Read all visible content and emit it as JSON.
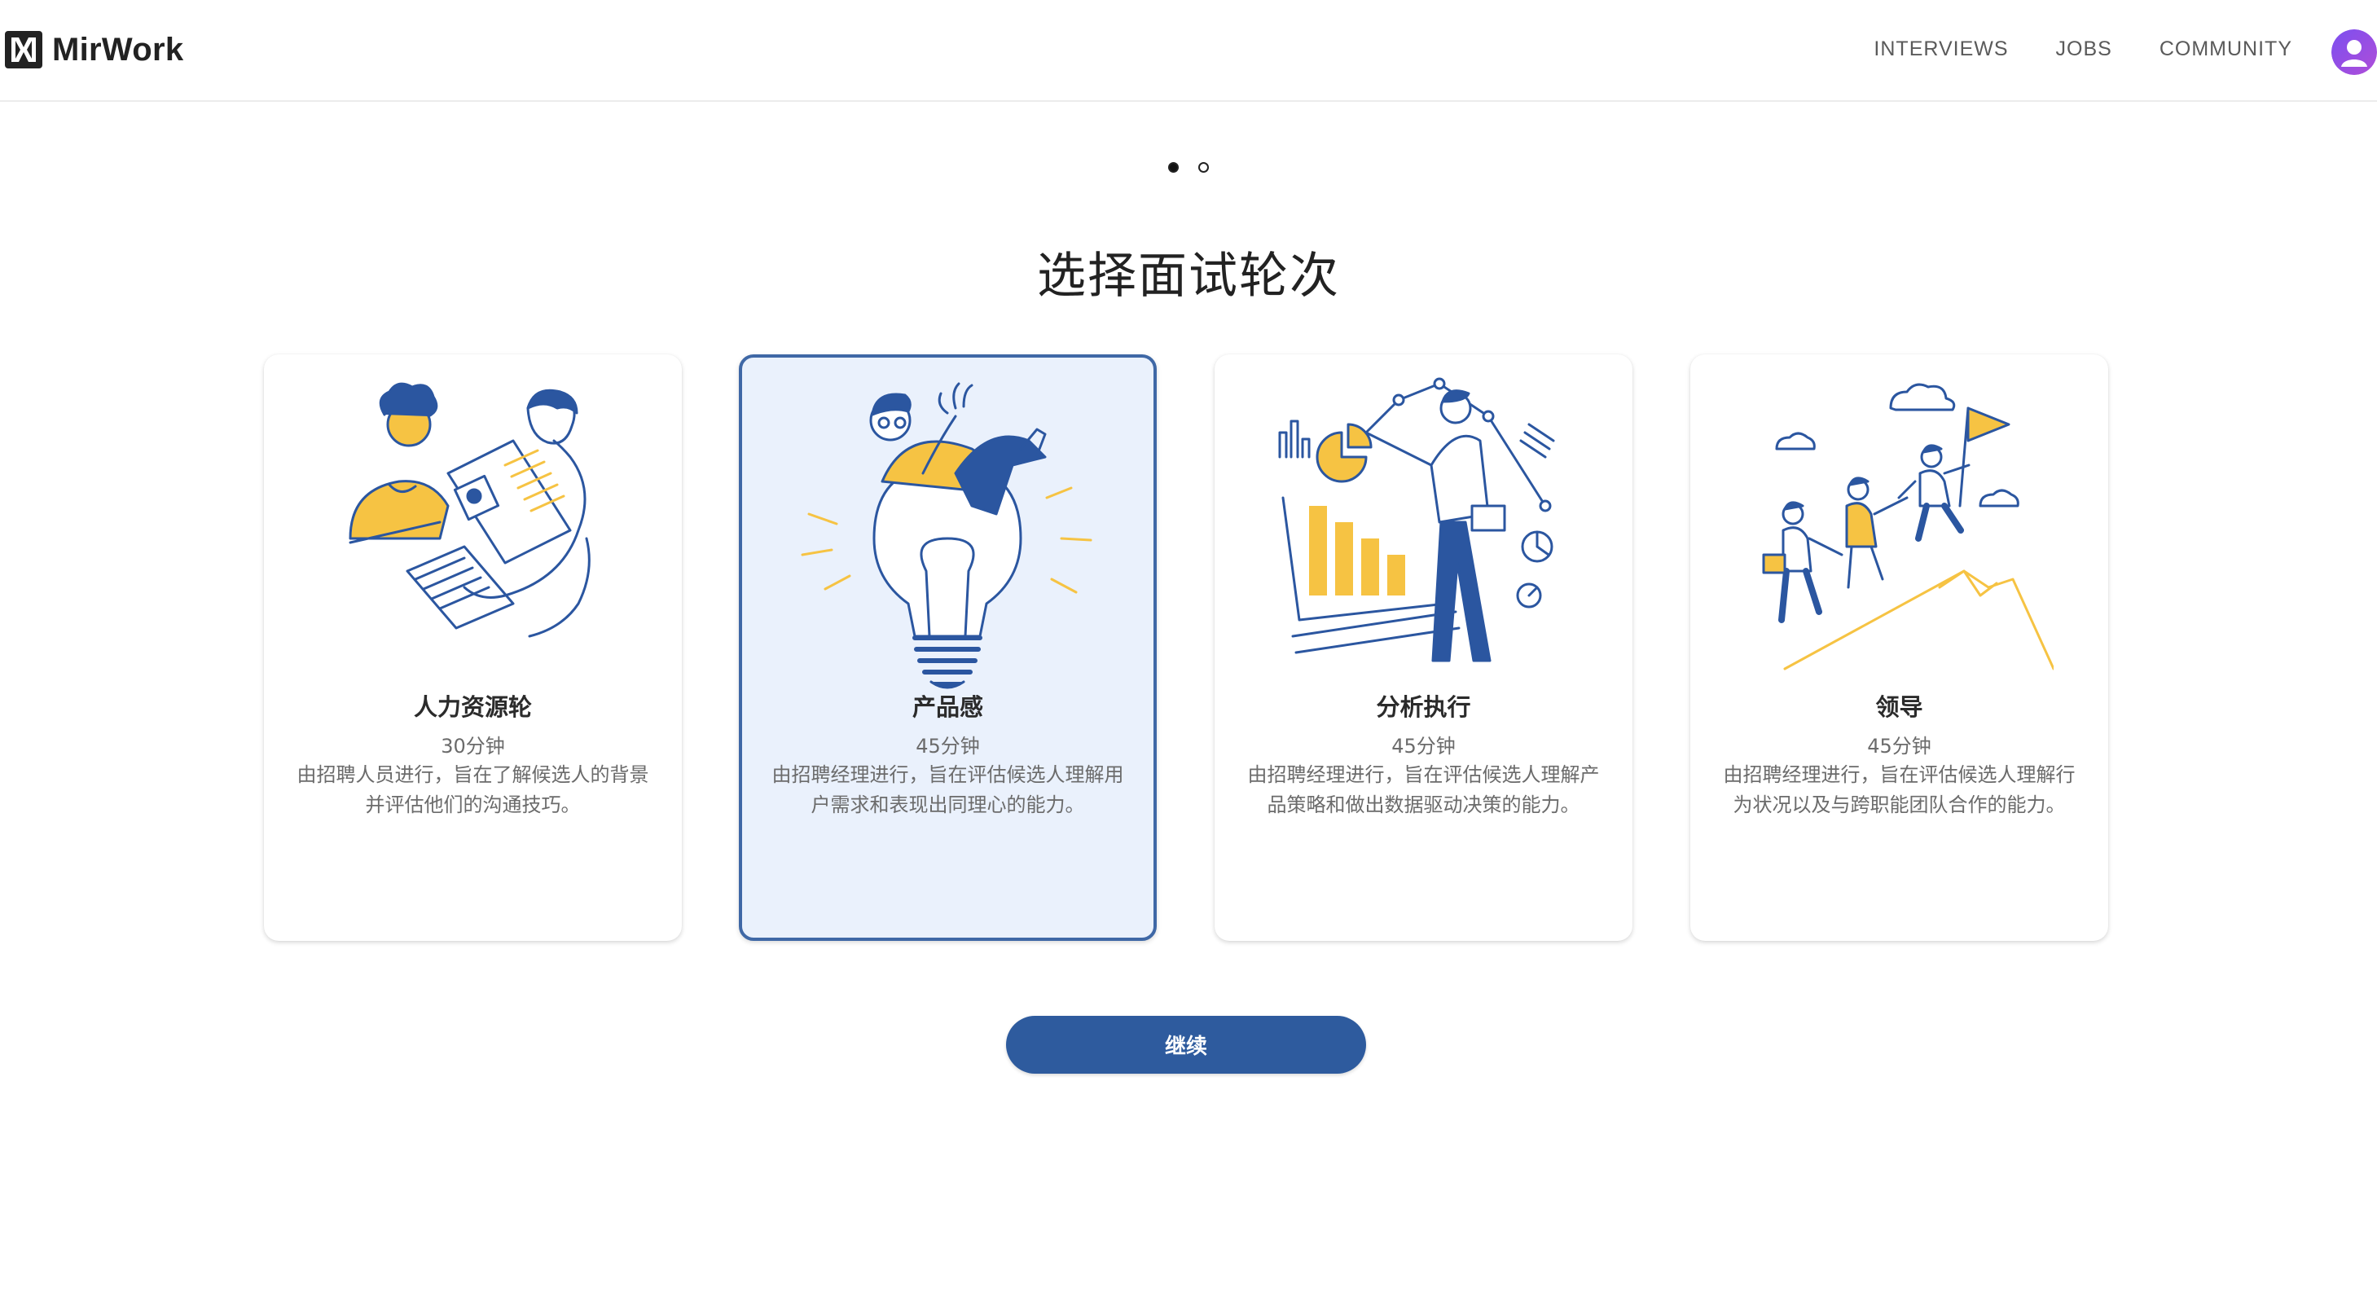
{
  "header": {
    "brand": "MirWork",
    "logo_icon": "mirwork-logo-icon",
    "nav": [
      {
        "label": "INTERVIEWS"
      },
      {
        "label": "JOBS"
      },
      {
        "label": "COMMUNITY"
      }
    ],
    "avatar_icon": "user-avatar-icon"
  },
  "carousel": {
    "pages": 2,
    "active_page": 1
  },
  "main": {
    "title": "选择面试轮次",
    "rounds": [
      {
        "title": "人力资源轮",
        "duration": "30分钟",
        "description": "由招聘人员进行，旨在了解候选人的背景并评估他们的沟通技巧。",
        "selected": false,
        "illustration": "hr-interview-illustration"
      },
      {
        "title": "产品感",
        "duration": "45分钟",
        "description": "由招聘经理进行，旨在评估候选人理解用户需求和表现出同理心的能力。",
        "selected": true,
        "illustration": "lightbulb-idea-illustration"
      },
      {
        "title": "分析执行",
        "duration": "45分钟",
        "description": "由招聘经理进行，旨在评估候选人理解产品策略和做出数据驱动决策的能力。",
        "selected": false,
        "illustration": "data-analysis-illustration"
      },
      {
        "title": "领导",
        "duration": "45分钟",
        "description": "由招聘经理进行，旨在评估候选人理解行为状况以及与跨职能团队合作的能力。",
        "selected": false,
        "illustration": "team-climbing-illustration"
      }
    ],
    "continue_label": "继续"
  },
  "colors": {
    "primary": "#2e5b9e",
    "accent_yellow": "#f6c343",
    "illustration_blue": "#2b56a0",
    "selected_bg": "#eaf1fc",
    "selected_border": "#3f68a6"
  }
}
